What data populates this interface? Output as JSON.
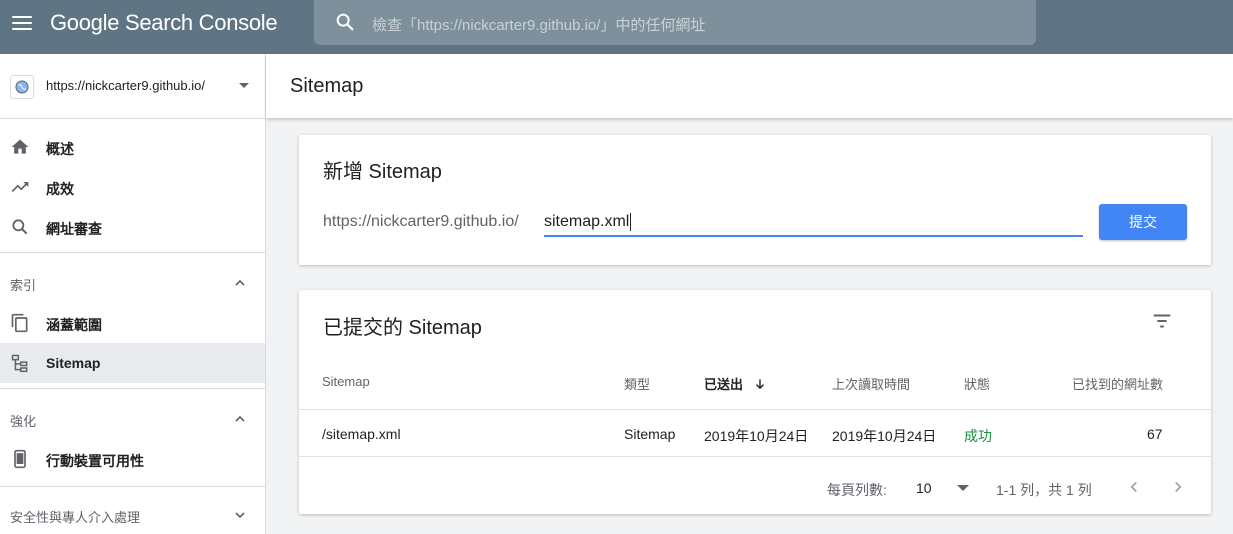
{
  "topbar": {
    "app_name": "Google Search Console",
    "search_placeholder": "檢查「https://nickcarter9.github.io/」中的任何網址"
  },
  "sidebar": {
    "property_url": "https://nickcarter9.github.io/",
    "items": [
      {
        "label": "概述",
        "icon": "home-icon"
      },
      {
        "label": "成效",
        "icon": "trending-up-icon"
      },
      {
        "label": "網址審查",
        "icon": "search-icon"
      }
    ],
    "sections": [
      {
        "label": "索引",
        "items": [
          {
            "label": "涵蓋範圍",
            "icon": "copy-icon"
          },
          {
            "label": "Sitemap",
            "icon": "sitemap-icon"
          }
        ]
      },
      {
        "label": "強化",
        "items": [
          {
            "label": "行動裝置可用性",
            "icon": "smartphone-icon"
          }
        ]
      },
      {
        "label": "安全性與專人介入處理",
        "items": []
      }
    ]
  },
  "main": {
    "title": "Sitemap",
    "add_card": {
      "title": "新增 Sitemap",
      "prefix": "https://nickcarter9.github.io/",
      "input_value": "sitemap.xml",
      "submit_label": "提交"
    },
    "submitted_card": {
      "title": "已提交的 Sitemap",
      "columns": [
        "Sitemap",
        "類型",
        "已送出",
        "上次讀取時間",
        "狀態",
        "已找到的網址數"
      ],
      "rows": [
        {
          "sitemap": "/sitemap.xml",
          "type": "Sitemap",
          "submitted": "2019年10月24日",
          "last_read": "2019年10月24日",
          "status": "成功",
          "urls_found": "67"
        }
      ],
      "pagination": {
        "rows_per_page_label": "每頁列數:",
        "rows_per_page": "10",
        "range_text": "1-1 列，共 1 列"
      }
    }
  },
  "colors": {
    "topbar": "#5f7583",
    "accent": "#4285f4",
    "success": "#1e8e3e"
  }
}
